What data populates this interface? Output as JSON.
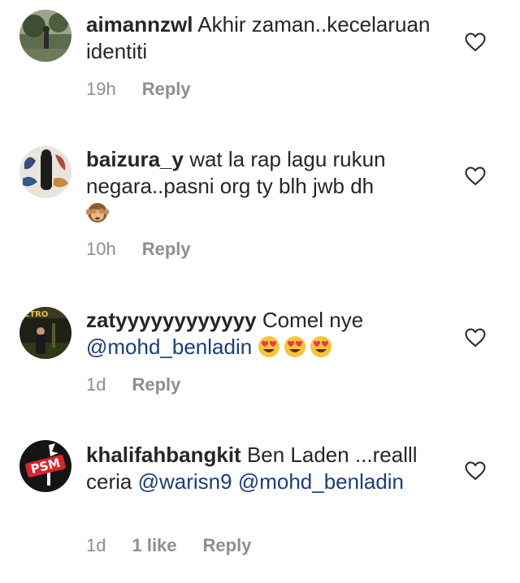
{
  "comments": [
    {
      "username": "aimannzwl",
      "text": "Akhir zaman..kecelaruan identiti",
      "time": "19h",
      "reply_label": "Reply",
      "avatar_icon": "profile-photo"
    },
    {
      "username": "baizura_y",
      "text": "wat la rap lagu rukun negara..pasni org ty blh jwb dh",
      "emoji": "see-no-evil-monkey",
      "time": "10h",
      "reply_label": "Reply",
      "avatar_icon": "profile-photo"
    },
    {
      "username": "zatyyyyyyyyyyyy",
      "text": "Comel nye",
      "mention": "@mohd_benladin",
      "emojis": [
        "heart-eyes",
        "heart-eyes",
        "heart-eyes"
      ],
      "time": "1d",
      "reply_label": "Reply",
      "avatar_icon": "profile-photo"
    },
    {
      "username": "khalifahbangkit",
      "text": "Ben Laden ...realll ceria",
      "mention1": "@warisn9",
      "mention2": "@mohd_benladin",
      "time": "1d",
      "likes": "1 like",
      "reply_label": "Reply",
      "avatar_icon": "psm-logo",
      "avatar_text": "PSM"
    }
  ],
  "colors": {
    "mention": "#1a3e7a",
    "meta": "#8e8e8e",
    "text": "#262626"
  }
}
